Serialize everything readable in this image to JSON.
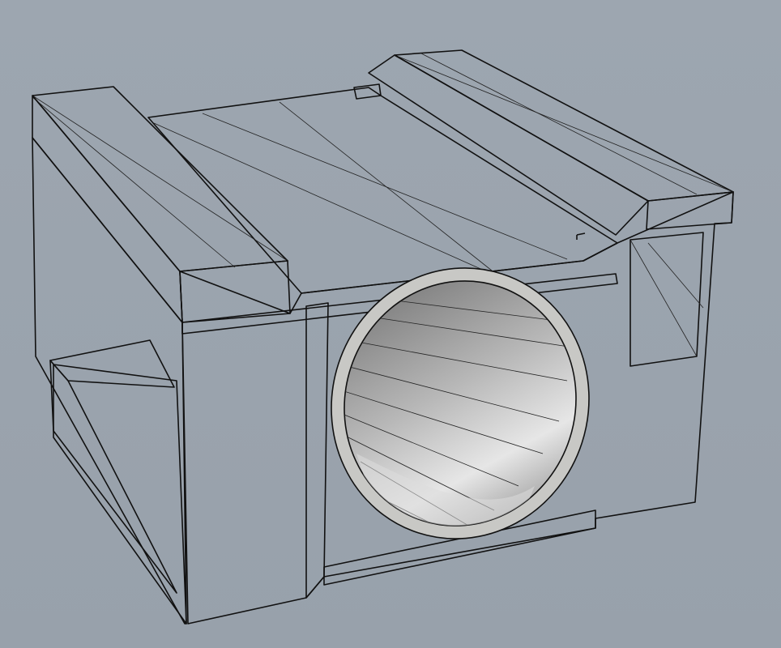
{
  "viewport": {
    "background": "#9aa3ad",
    "mesh_color": "#2a2a2a",
    "face_light": "#cfcfcc",
    "face_mid": "#b4b4b1",
    "face_dark": "#8e8e8c",
    "top_face": "#8c8c8b"
  }
}
